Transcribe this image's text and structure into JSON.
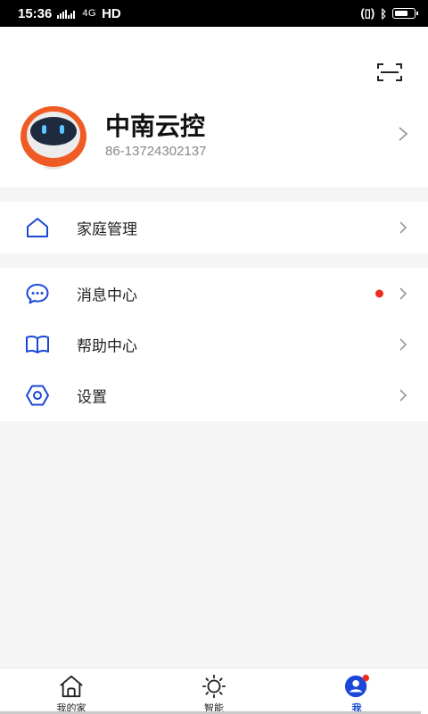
{
  "status_bar": {
    "time": "15:36",
    "network_text": "HD",
    "signal_indicators": "4G"
  },
  "profile": {
    "name": "中南云控",
    "phone": "86-13724302137"
  },
  "menu": {
    "home_management": "家庭管理",
    "items": [
      {
        "label": "消息中心",
        "icon": "chat-bubble-icon",
        "has_badge": true
      },
      {
        "label": "帮助中心",
        "icon": "book-icon",
        "has_badge": false
      },
      {
        "label": "设置",
        "icon": "hexagon-settings-icon",
        "has_badge": false
      }
    ]
  },
  "tabs": [
    {
      "label": "我的家",
      "icon": "home-icon",
      "active": false
    },
    {
      "label": "智能",
      "icon": "sun-icon",
      "active": false
    },
    {
      "label": "我",
      "icon": "profile-icon",
      "active": true
    }
  ],
  "colors": {
    "accent": "#1a47d8",
    "badge": "#ee2b1f",
    "avatar_orange": "#f05a24"
  }
}
